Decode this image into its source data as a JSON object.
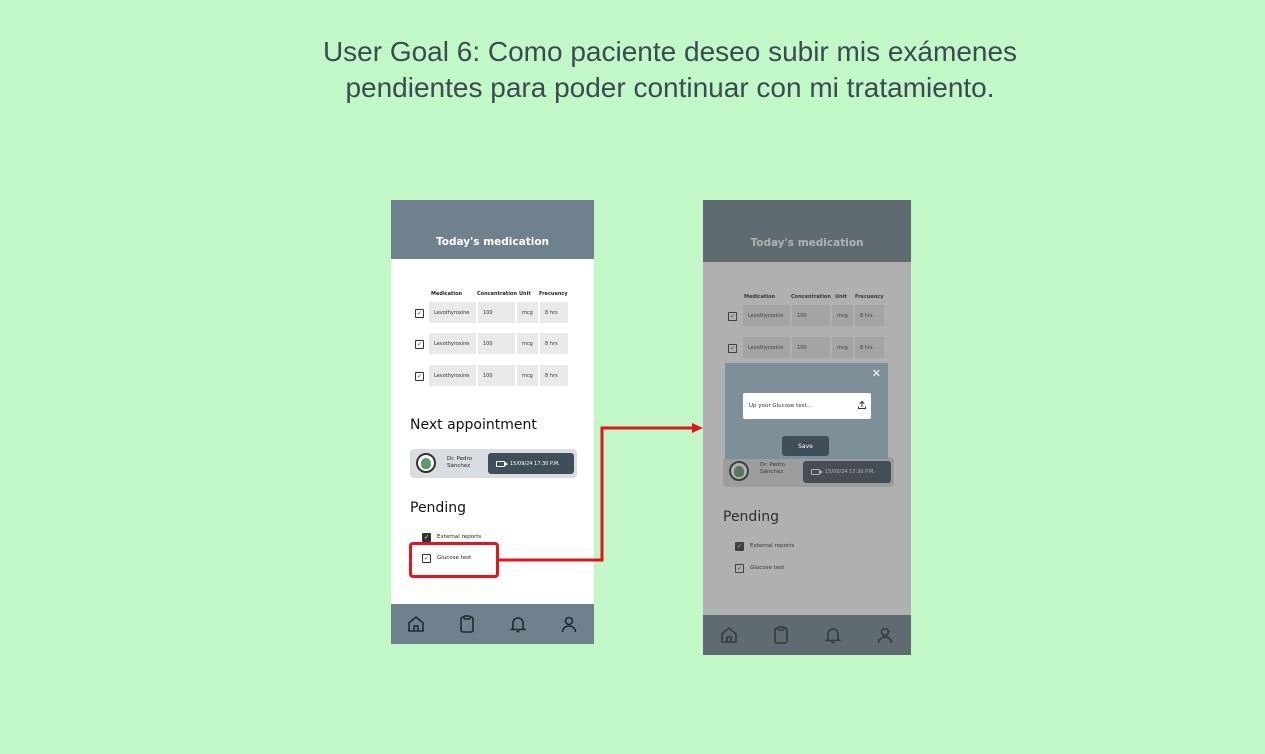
{
  "slide": {
    "title_line1": "User Goal 6: Como paciente deseo subir mis exámenes",
    "title_line2": "pendientes para poder continuar con mi tratamiento."
  },
  "screen": {
    "header_title": "Today's medication",
    "table_headers": [
      "Medication",
      "Concentration",
      "Unit",
      "Frecuency"
    ],
    "medications": [
      {
        "name": "Levothyroxine",
        "concentration": "100",
        "unit": "mcg",
        "frequency": "8 hrs"
      },
      {
        "name": "Levothyroxine",
        "concentration": "100",
        "unit": "mcg",
        "frequency": "8 hrs"
      },
      {
        "name": "Levothyroxine",
        "concentration": "100",
        "unit": "mcg",
        "frequency": "8 hrs"
      }
    ],
    "next_appointment_title": "Next appointment",
    "doctor_name_line1": "Dr. Pedro",
    "doctor_name_line2": "Sánchez",
    "appointment_datetime": "15/09/24 17:30 P.M.",
    "pending_title": "Pending",
    "pending_items": [
      "External reports",
      "Glucose test"
    ],
    "nav_icons": [
      "home-icon",
      "clipboard-icon",
      "bell-icon",
      "user-icon"
    ]
  },
  "modal": {
    "close_label": "✕",
    "upload_placeholder": "Up your Glucose test...",
    "save_label": "Save"
  },
  "colors": {
    "background": "#c2f7c7",
    "header": "#6e818c",
    "highlight": "#e3151a"
  }
}
